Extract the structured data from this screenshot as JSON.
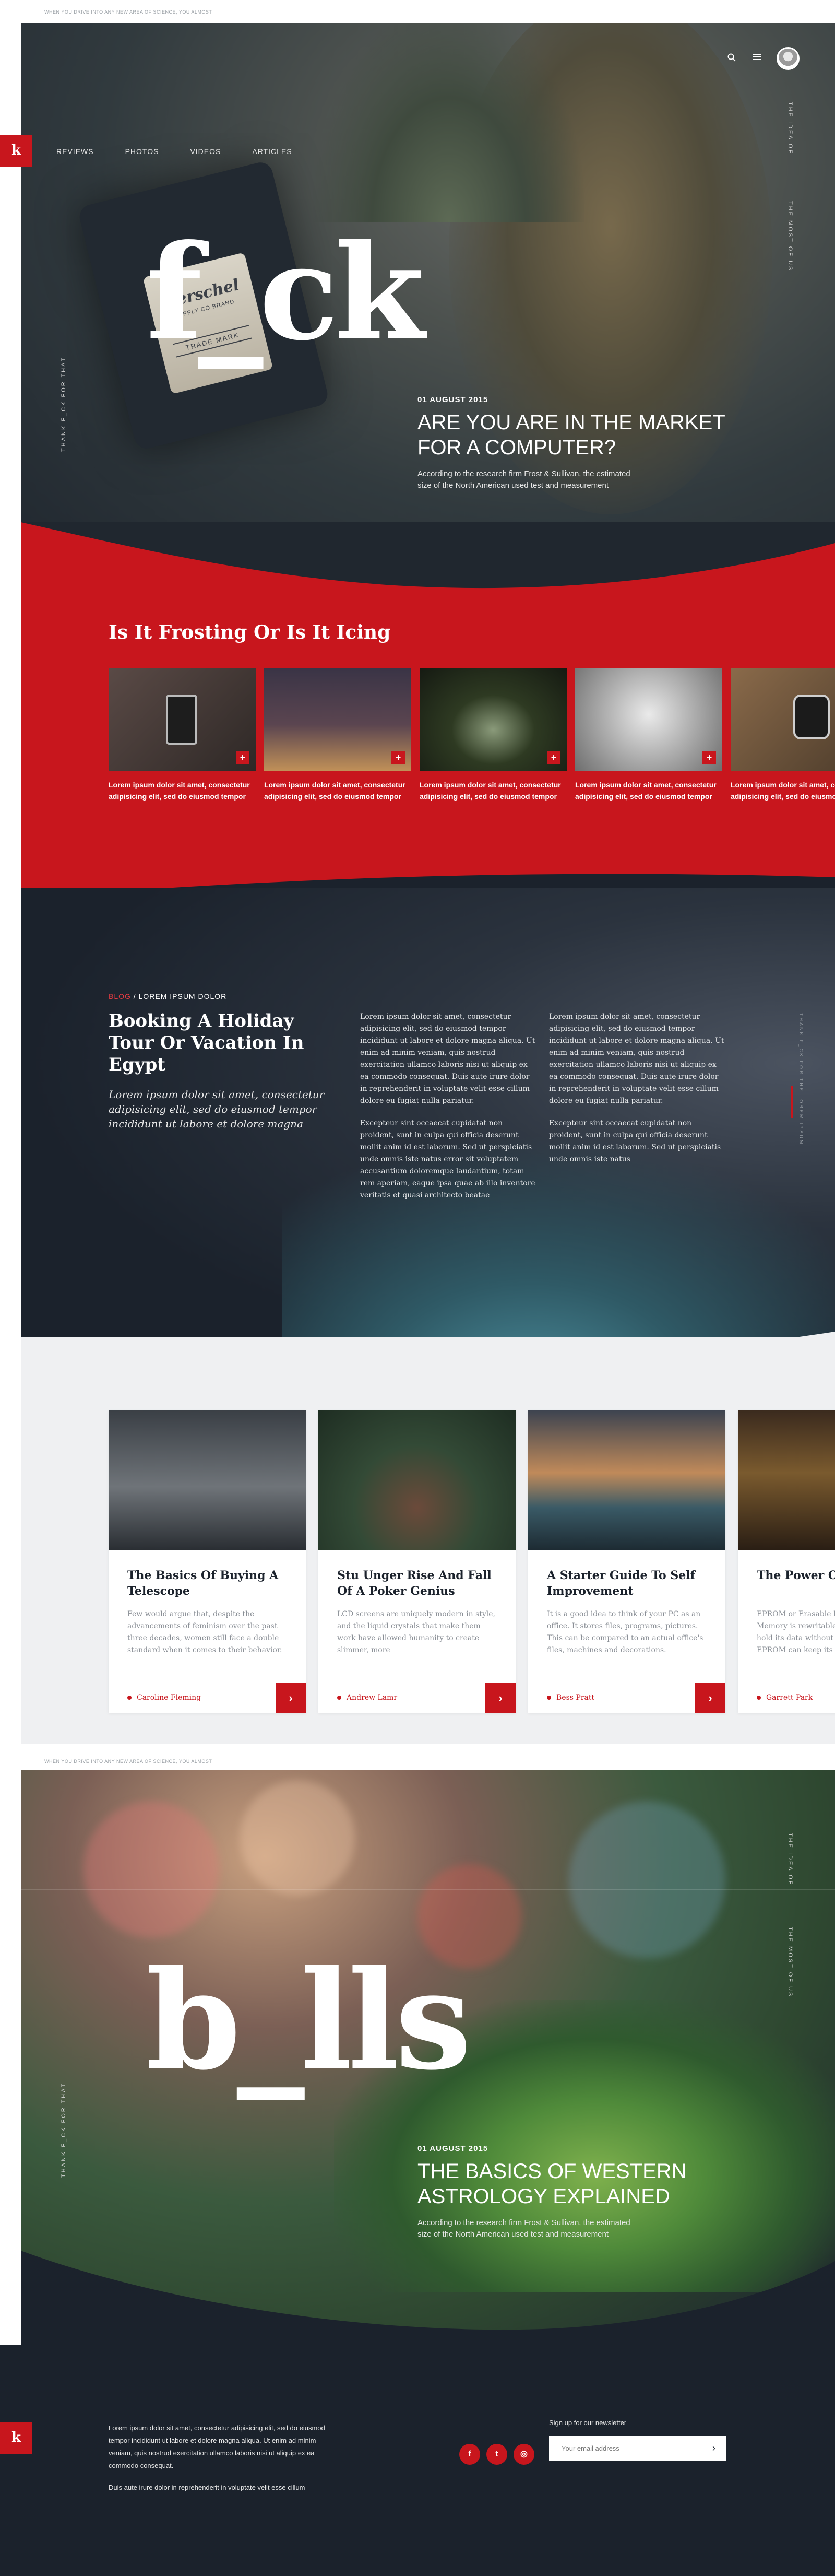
{
  "captions": {
    "top": "WHEN YOU DRIVE INTO ANY NEW AREA OF SCIENCE, YOU ALMOST",
    "middle": "WHEN YOU DRIVE INTO ANY NEW AREA OF SCIENCE, YOU ALMOST"
  },
  "brand": {
    "logo_letter": "k"
  },
  "nav": {
    "items": [
      "REVIEWS",
      "PHOTOS",
      "VIDEOS",
      "ARTICLES"
    ]
  },
  "top_icons": {
    "search": "search-icon",
    "menu": "menu-icon",
    "avatar": "avatar"
  },
  "hero1": {
    "side_left": "THANK F_CK FOR THAT",
    "side_right_a": "THE IDEA OF",
    "side_right_b": "THE MOST OF US",
    "big_word": "f_ck",
    "date": "01 AUGUST 2015",
    "title_line1": "ARE YOU ARE IN THE MARKET",
    "title_line2": "FOR A COMPUTER?",
    "desc_line1": "According to the research firm Frost & Sullivan, the estimated",
    "desc_line2": "size of the North American used test and measurement",
    "patch_brand": "Herschel",
    "patch_sub": "SUPPLY CO BRAND",
    "patch_tm": "TRADE MARK"
  },
  "frosting": {
    "heading": "Is It Frosting Or Is It Icing",
    "items": [
      {
        "line1": "Lorem ipsum dolor sit amet, consectetur",
        "line2": "adipisicing elit, sed do eiusmod tempor"
      },
      {
        "line1": "Lorem ipsum dolor sit amet, consectetur",
        "line2": "adipisicing elit, sed do eiusmod tempor"
      },
      {
        "line1": "Lorem ipsum dolor sit amet, consectetur",
        "line2": "adipisicing elit, sed do eiusmod tempor"
      },
      {
        "line1": "Lorem ipsum dolor sit amet, consectetur",
        "line2": "adipisicing elit, sed do eiusmod tempor"
      },
      {
        "line1": "Lorem ipsum dolor sit amet, consectetur",
        "line2": "adipisicing elit, sed do eiusmod tempor"
      }
    ],
    "plus": "+"
  },
  "article": {
    "category": "BLOG",
    "category_rest": "/ LOREM IPSUM DOLOR",
    "title": "Booking A Holiday Tour Or Vacation In Egypt",
    "lead": "Lorem ipsum dolor sit amet, consectetur adipisicing elit, sed do eiusmod tempor incididunt ut labore et dolore magna",
    "col1_p1": "Lorem ipsum dolor sit amet, consectetur adipisicing elit, sed do eiusmod tempor incididunt ut labore et dolore magna aliqua. Ut enim ad minim veniam, quis nostrud exercitation ullamco laboris nisi ut aliquip ex ea commodo consequat. Duis aute irure dolor in reprehenderit in voluptate velit esse cillum dolore eu fugiat nulla pariatur.",
    "col1_p2": "Excepteur sint occaecat cupidatat non proident, sunt in culpa qui officia deserunt mollit anim id est laborum. Sed ut perspiciatis unde omnis iste natus error sit voluptatem accusantium doloremque laudantium, totam rem aperiam, eaque ipsa quae ab illo inventore veritatis et quasi architecto beatae",
    "col2_p1": "Lorem ipsum dolor sit amet, consectetur adipisicing elit, sed do eiusmod tempor incididunt ut labore et dolore magna aliqua. Ut enim ad minim veniam, quis nostrud exercitation ullamco laboris nisi ut aliquip ex ea commodo consequat. Duis aute irure dolor in reprehenderit in voluptate velit esse cillum dolore eu fugiat nulla pariatur.",
    "col2_p2": "Excepteur sint occaecat cupidatat non proident, sunt in culpa qui officia deserunt mollit anim id est laborum. Sed ut perspiciatis unde omnis iste natus",
    "side_text": "THANK F_CK FOR THE LOREM IPSUM"
  },
  "cards": [
    {
      "title": "The Basics Of Buying A Telescope",
      "excerpt": "Few would argue that, despite the advancements of feminism over the past three decades, women still face a double standard when it comes to their behavior.",
      "author": "Caroline Fleming"
    },
    {
      "title": "Stu Unger Rise And Fall Of A Poker Genius",
      "excerpt": "LCD screens are uniquely modern in style, and the liquid crystals that make them work have allowed humanity to create slimmer, more",
      "author": "Andrew Lamr"
    },
    {
      "title": "A Starter Guide To Self Improvement",
      "excerpt": "It is a good idea to think of your PC as an office. It stores files, programs, pictures. This can be compared to an actual office's files, machines and decorations.",
      "author": "Bess Pratt"
    },
    {
      "title": "The Power O",
      "excerpt": "EPROM or Erasable Pro Memory is rewritable c hold its data without p EPROM can keep its da",
      "author": "Garrett Park"
    }
  ],
  "card_arrow": "›",
  "hero2": {
    "side_left": "THANK F_CK FOR THAT",
    "side_right_a": "THE IDEA OF",
    "side_right_b": "THE MOST OF US",
    "big_word": "b_lls",
    "date": "01 AUGUST 2015",
    "title_line1": "THE BASICS OF WESTERN",
    "title_line2": "ASTROLOGY EXPLAINED",
    "desc_line1": "According to the research firm Frost & Sullivan, the estimated",
    "desc_line2": "size of the North American used test and measurement"
  },
  "footer": {
    "p1": "Lorem ipsum dolor sit amet, consectetur adipisicing elit, sed do eiusmod tempor incididunt ut labore et dolore magna aliqua. Ut enim ad minim veniam, quis nostrud exercitation ullamco laboris nisi ut aliquip ex ea commodo consequat.",
    "p2": "Duis aute irure dolor in reprehenderit in voluptate velit esse cillum",
    "social": [
      "f",
      "t",
      "◎"
    ],
    "newsletter_label": "Sign up for our newsletter",
    "email_placeholder": "Your email address",
    "submit_arrow": "›"
  },
  "colors": {
    "accent": "#c8161d",
    "dark": "#1b222c",
    "light_bg": "#eff0f2"
  }
}
